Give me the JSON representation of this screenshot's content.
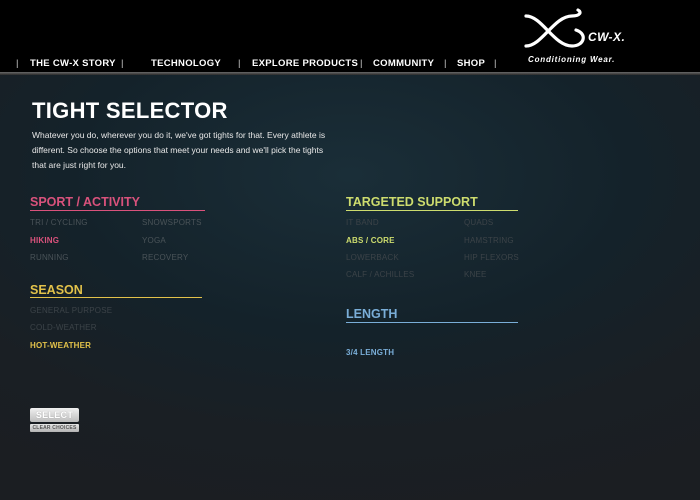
{
  "nav": {
    "items": [
      "THE CW-X STORY",
      "TECHNOLOGY",
      "EXPLORE PRODUCTS",
      "COMMUNITY",
      "SHOP"
    ]
  },
  "brand": {
    "name": "CW-X.",
    "tagline": "Conditioning Wear."
  },
  "page": {
    "title": "TIGHT SELECTOR",
    "intro": "Whatever you do, wherever you do it, we've got tights for that. Every athlete is different. So choose the options that meet your needs and we'll pick the tights that are just right for you."
  },
  "sport": {
    "title": "SPORT / ACTIVITY",
    "color": "#d9527c",
    "options": [
      "TRI / CYCLING",
      "SNOWSPORTS",
      "HIKING",
      "YOGA",
      "RUNNING",
      "RECOVERY"
    ],
    "selected": "HIKING"
  },
  "season": {
    "title": "SEASON",
    "color": "#e3c24a",
    "options": [
      "GENERAL PURPOSE",
      "COLD-WEATHER",
      "HOT-WEATHER"
    ],
    "selected": "HOT-WEATHER"
  },
  "support": {
    "title": "TARGETED SUPPORT",
    "color": "#cddc6e",
    "options": [
      "IT BAND",
      "QUADS",
      "ABS / CORE",
      "HAMSTRING",
      "LOWERBACK",
      "HIP FLEXORS",
      "CALF / ACHILLES",
      "KNEE"
    ],
    "selected": "ABS / CORE"
  },
  "length": {
    "title": "LENGTH",
    "color": "#7aaed8",
    "options": [
      "3/4 LENGTH"
    ],
    "selected": "3/4 LENGTH"
  },
  "buttons": {
    "select": "SELECT",
    "clear": "CLEAR CHOICES"
  }
}
